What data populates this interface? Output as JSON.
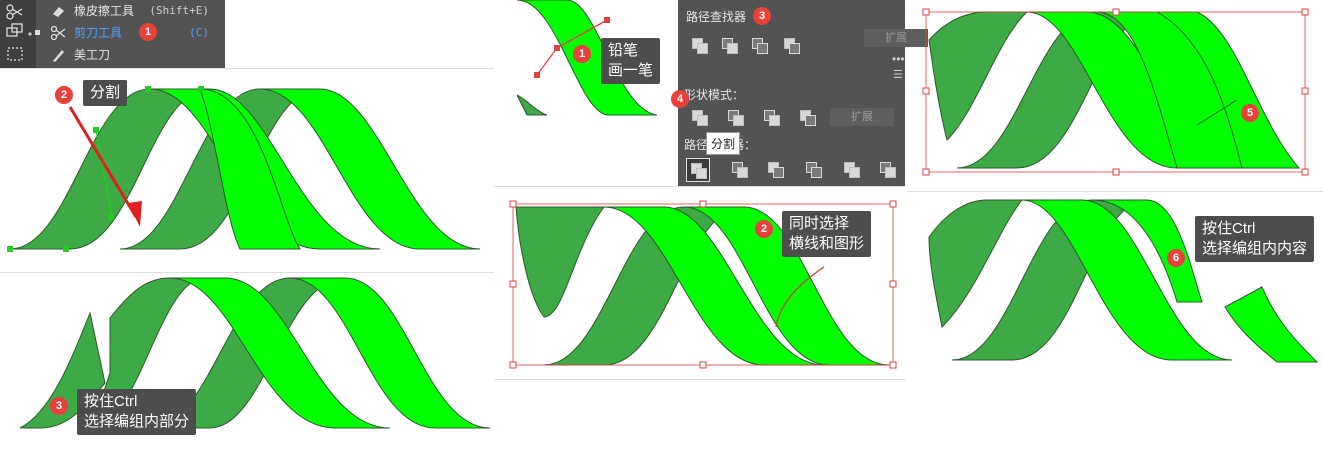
{
  "menu": {
    "items": [
      {
        "label": "橡皮擦工具",
        "shortcut": "(Shift+E)"
      },
      {
        "label": "剪刀工具",
        "shortcut": "(C)"
      },
      {
        "label": "美工刀",
        "shortcut": ""
      }
    ],
    "badge": "1"
  },
  "step_split": {
    "badge": "2",
    "label": "分割"
  },
  "step_ctrl_part": {
    "badge": "3",
    "line1": "按住Ctrl",
    "line2": "选择编组内部分"
  },
  "step_pencil": {
    "badge": "1",
    "line1": "铅笔",
    "line2": "画一笔"
  },
  "pathfinder": {
    "title": "路径查找器",
    "title_badge": "3",
    "expand_top": "扩展",
    "shape_modes_label": "形状模式：",
    "shape_badge": "4",
    "expand_mid": "扩展",
    "pathfinders_label": "路径查找器：",
    "tooltip": "分割"
  },
  "step_select_both": {
    "badge": "2",
    "line1": "同时选择",
    "line2": "横线和图形"
  },
  "step_result": {
    "badge": "5"
  },
  "step_ctrl_group": {
    "badge": "6",
    "line1": "按住Ctrl",
    "line2": "选择编组内内容"
  },
  "colors": {
    "green_bright": "#00ff00",
    "green_dark": "#3daa45",
    "badge": "#e8403a",
    "panel": "#535353",
    "callout": "#4d4d4d",
    "selection": "#e04040"
  }
}
